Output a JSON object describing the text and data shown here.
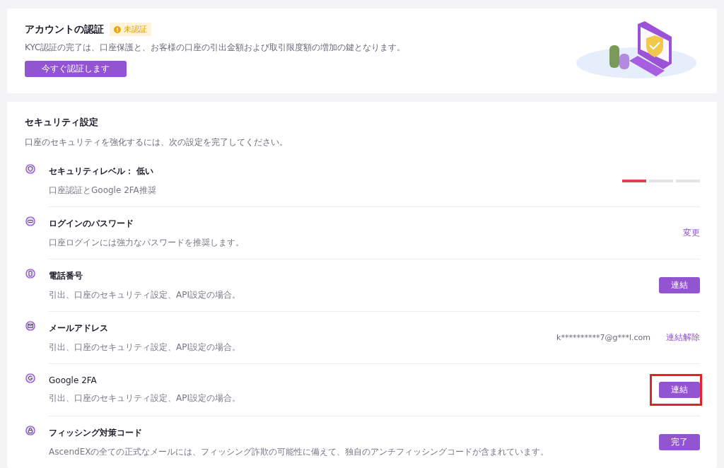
{
  "verification": {
    "title": "アカウントの認証",
    "badge": "未認証",
    "description": "KYC認証の完了は、口座保護と、お客様の口座の引出金額および取引限度額の増加の鍵となります。",
    "button": "今すぐ認証します"
  },
  "security": {
    "title": "セキュリティ設定",
    "subtitle": "口座のセキュリティを強化するには、次の設定を完了してください。",
    "items": [
      {
        "title": "セキュリティレベル： 低い",
        "description": "口座認証とGoogle 2FA推奨",
        "kind": "meter",
        "level": 0.33
      },
      {
        "title": "ログインのパスワード",
        "description": "口座ログインには強力なパスワードを推奨します。",
        "kind": "link",
        "action": "変更"
      },
      {
        "title": "電話番号",
        "description": "引出、口座のセキュリティ設定、API設定の場合。",
        "kind": "button",
        "action": "連結",
        "highlighted": false
      },
      {
        "title": "メールアドレス",
        "description": "引出、口座のセキュリティ設定、API設定の場合。",
        "kind": "link",
        "value": "k**********7@g***l.com",
        "action": "連結解除"
      },
      {
        "title": "Google 2FA",
        "description": "引出、口座のセキュリティ設定、API設定の場合。",
        "kind": "button",
        "action": "連結",
        "highlighted": true
      },
      {
        "title": "フィッシング対策コード",
        "description": "AscendEXの全ての正式なメールには、フィッシング詐欺の可能性に備えて、独自のアンチフィッシングコードが含まれています。",
        "kind": "button",
        "action": "完了",
        "highlighted": false
      }
    ]
  }
}
